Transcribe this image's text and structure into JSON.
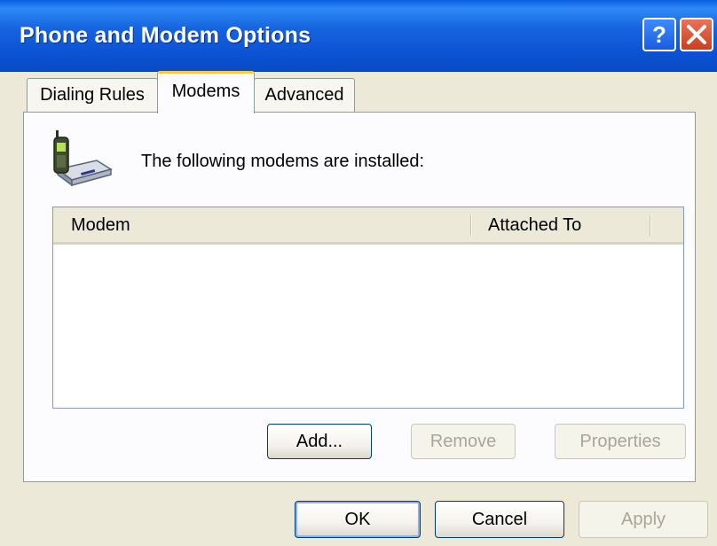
{
  "window": {
    "title": "Phone and Modem Options",
    "help_label": "?",
    "colors": {
      "titlebar": "#0B53D4",
      "dialog_bg": "#ECE9D8",
      "tab_accent": "#FFC83C",
      "close_button": "#C9401F"
    }
  },
  "tabs": [
    {
      "label": "Dialing Rules",
      "selected": false
    },
    {
      "label": "Modems",
      "selected": true
    },
    {
      "label": "Advanced",
      "selected": false
    }
  ],
  "modems_tab": {
    "icon": "phone-modem-icon",
    "description": "The following modems are  installed:",
    "list": {
      "columns": [
        "Modem",
        "Attached To"
      ],
      "rows": []
    },
    "buttons": {
      "add": "Add...",
      "remove": "Remove",
      "properties": "Properties"
    }
  },
  "footer": {
    "ok": "OK",
    "cancel": "Cancel",
    "apply": "Apply"
  }
}
